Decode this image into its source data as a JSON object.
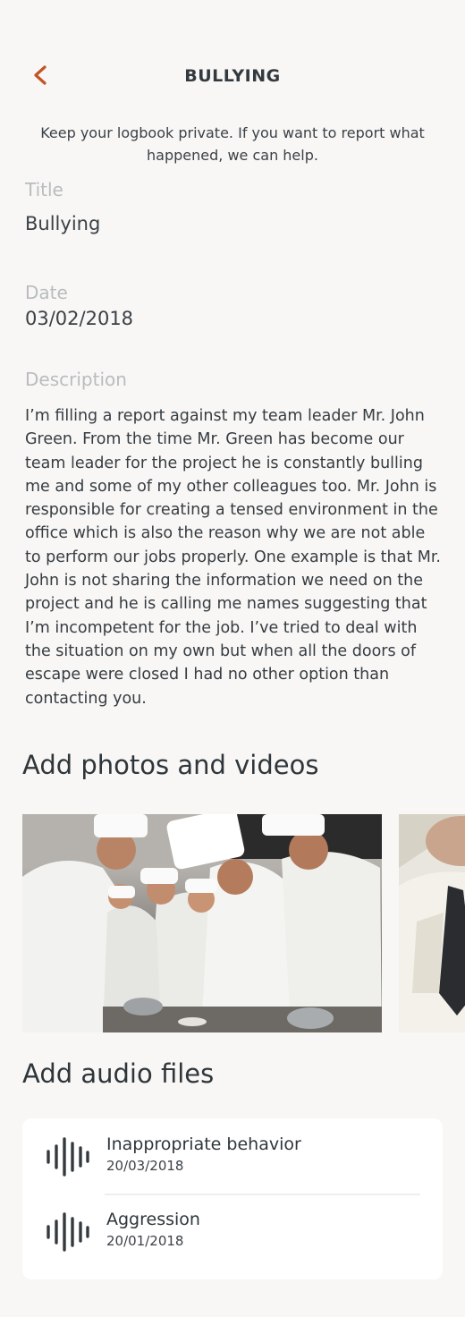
{
  "header": {
    "title": "BULLYING",
    "back_icon": "chevron-left-icon",
    "accent_color": "#c25525"
  },
  "subtitle": "Keep your logbook private. If you want to report what happened, we can help.",
  "fields": {
    "title_label": "Title",
    "title_value": "Bullying",
    "date_label": "Date",
    "date_value": "03/02/2018",
    "description_label": "Description",
    "description_value": "I’m filling a report against my team leader Mr. John Green. From the time Mr. Green has become our team leader for the project he is constantly bulling me and some of my other colleagues too. Mr. John is responsible for creating a tensed environment in the office which is also the reason why we are not able to perform our jobs properly. One example is that Mr. John is not sharing the information we need on the project and he is calling me names suggesting that I’m incompetent for the job. I’ve tried to deal with the situation on my own but when all the doors of escape were closed I had no other option than contacting you."
  },
  "photos": {
    "section_title": "Add photos and videos"
  },
  "audio": {
    "section_title": "Add audio files",
    "items": [
      {
        "title": "Inappropriate behavior",
        "date": "20/03/2018",
        "icon": "audio-waveform-icon"
      },
      {
        "title": "Aggression",
        "date": "20/01/2018",
        "icon": "audio-waveform-icon"
      }
    ]
  }
}
